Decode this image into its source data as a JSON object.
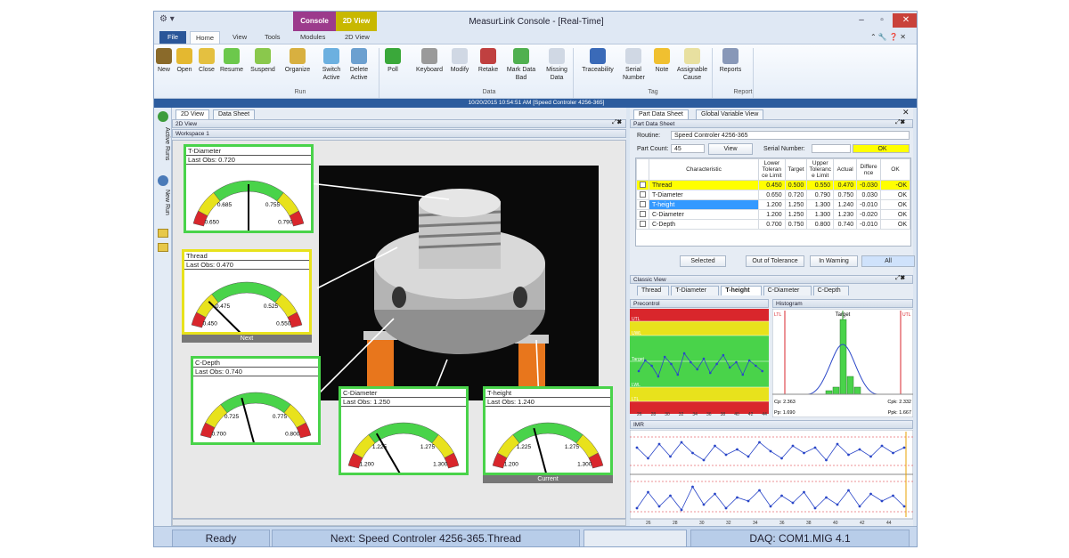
{
  "window": {
    "title": "MeasurLink Console - [Real-Time]",
    "context_tabs": [
      "Console",
      "2D View"
    ],
    "context_subtabs": [
      "Modules",
      "2D View"
    ]
  },
  "ribbon": {
    "tabs": [
      "File",
      "Home",
      "View",
      "Tools"
    ],
    "buttons": [
      {
        "label": "New",
        "icon": "new-icon"
      },
      {
        "label": "Open",
        "icon": "open-folder-icon"
      },
      {
        "label": "Close",
        "icon": "close-folder-icon"
      },
      {
        "label": "Resume",
        "icon": "resume-icon"
      },
      {
        "label": "Suspend",
        "icon": "suspend-icon"
      },
      {
        "label": "Organize",
        "icon": "organize-icon"
      },
      {
        "label": "Switch Active",
        "icon": "switch-icon"
      },
      {
        "label": "Delete Active",
        "icon": "delete-icon"
      },
      {
        "label": "Poll",
        "icon": "poll-icon"
      },
      {
        "label": "Keyboard",
        "icon": "keyboard-icon"
      },
      {
        "label": "Modify",
        "icon": "modify-icon"
      },
      {
        "label": "Retake",
        "icon": "retake-icon"
      },
      {
        "label": "Mark Data Bad",
        "icon": "mark-bad-icon"
      },
      {
        "label": "Missing Data",
        "icon": "missing-data-icon"
      },
      {
        "label": "Traceability",
        "icon": "traceability-icon"
      },
      {
        "label": "Serial Number",
        "icon": "serial-number-icon"
      },
      {
        "label": "Note",
        "icon": "note-icon"
      },
      {
        "label": "Assignable Cause",
        "icon": "assignable-cause-icon"
      },
      {
        "label": "Reports",
        "icon": "printer-icon"
      }
    ],
    "groups": [
      "Run",
      "Data",
      "Tag",
      "Report"
    ]
  },
  "info_strip": "10/20/2015 10:54:51 AM [Speed Controler 4256-365]",
  "sidebar": {
    "items": [
      "Active Runs",
      "New Run"
    ]
  },
  "left_pane": {
    "tabs": [
      "2D View",
      "Data Sheet"
    ],
    "panel_title": "2D View",
    "workspace_title": "Workspace 1",
    "gauges": [
      {
        "name": "T-Diameter",
        "obs": "Last Obs: 0.720",
        "ll": "0.650",
        "lw": "0.685",
        "uw": "0.755",
        "ul": "0.790",
        "value": 0.72,
        "min": 0.65,
        "max": 0.79,
        "caption": ""
      },
      {
        "name": "Thread",
        "obs": "Last Obs: 0.470",
        "ll": "0.450",
        "lw": "0.475",
        "uw": "0.525",
        "ul": "0.550",
        "value": 0.47,
        "min": 0.45,
        "max": 0.55,
        "caption": "Next"
      },
      {
        "name": "C-Depth",
        "obs": "Last Obs: 0.740",
        "ll": "0.700",
        "lw": "0.725",
        "uw": "0.775",
        "ul": "0.800",
        "value": 0.74,
        "min": 0.7,
        "max": 0.8,
        "caption": ""
      },
      {
        "name": "C-Diameter",
        "obs": "Last Obs: 1.250",
        "ll": "1.200",
        "lw": "1.225",
        "uw": "1.275",
        "ul": "1.300",
        "value": 1.23,
        "min": 1.2,
        "max": 1.3,
        "caption": ""
      },
      {
        "name": "T-height",
        "obs": "Last Obs: 1.240",
        "ll": "1.200",
        "lw": "1.225",
        "uw": "1.275",
        "ul": "1.300",
        "value": 1.24,
        "min": 1.2,
        "max": 1.3,
        "caption": "Current"
      }
    ]
  },
  "right_pane": {
    "tabs": [
      "Part Data Sheet",
      "Global Variable View"
    ],
    "pds_title": "Part Data Sheet",
    "routine_label": "Routine:",
    "routine_value": "Speed Controler 4256-365",
    "part_count_label": "Part Count:",
    "part_count_value": "45",
    "view_button": "View",
    "serial_label": "Serial Number:",
    "ok_status": "OK",
    "table": {
      "headers": [
        "Characteristic",
        "Lower Toleran ce Limit",
        "Target",
        "Upper Toleranc e Limit",
        "Actual",
        "Differe nce",
        "OK"
      ],
      "rows": [
        [
          "Thread",
          "0.450",
          "0.500",
          "0.550",
          "0.470",
          "-0.030",
          "-OK"
        ],
        [
          "T-Diameter",
          "0.650",
          "0.720",
          "0.790",
          "0.750",
          "0.030",
          "OK"
        ],
        [
          "T-height",
          "1.200",
          "1.250",
          "1.300",
          "1.240",
          "-0.010",
          "OK"
        ],
        [
          "C-Diameter",
          "1.200",
          "1.250",
          "1.300",
          "1.230",
          "-0.020",
          "OK"
        ],
        [
          "C-Depth",
          "0.700",
          "0.750",
          "0.800",
          "0.740",
          "-0.010",
          "OK"
        ]
      ]
    },
    "filter_buttons": [
      "Selected",
      "Out of Tolerance",
      "In Warning",
      "All"
    ],
    "classic_title": "Classic View",
    "classic_tabs": [
      "Thread",
      "T-Diameter",
      "T-height",
      "C-Diameter",
      "C-Depth"
    ],
    "precontrol_title": "Precontrol",
    "precontrol_labels": [
      "UTL",
      "UWL",
      "Target",
      "LWL",
      "LTL"
    ],
    "precontrol_xticks": [
      "26",
      "28",
      "30",
      "32",
      "34",
      "36",
      "38",
      "40",
      "42",
      "44"
    ],
    "histogram_title": "Histogram",
    "histogram_labels": {
      "ltl": "LTL",
      "target": "Target",
      "utl": "UTL"
    },
    "histogram_stats": {
      "cp": "Cp: 2.363",
      "cpk": "Cpk: 2.332",
      "pp": "Pp: 1.690",
      "ppk": "Ppk: 1.667"
    },
    "imr_title": "IMR",
    "imr_xticks": [
      "26",
      "28",
      "30",
      "32",
      "34",
      "36",
      "38",
      "40",
      "42",
      "44"
    ]
  },
  "status": {
    "ready": "Ready",
    "next": "Next: Speed Controler 4256-365.Thread",
    "empty": "",
    "daq": "DAQ: COM1.MIG 4.1"
  },
  "colors": {
    "green": "#49d34a",
    "yellow": "#e8e21c",
    "red": "#d9262c",
    "accent": "#2c5c9e"
  }
}
